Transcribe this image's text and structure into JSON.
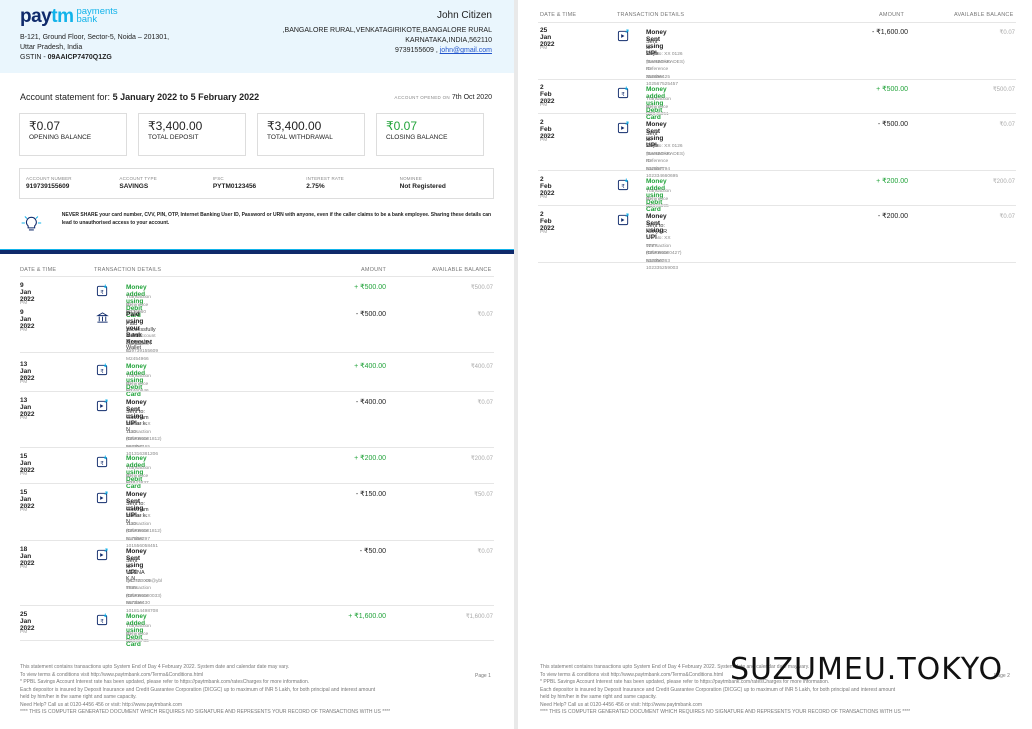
{
  "header": {
    "logo_brand": "paytm",
    "logo_sub1": "payments",
    "logo_sub2": "bank",
    "address1": "B-121, Ground Floor, Sector-5, Noida – 201301,",
    "address2": "Uttar Pradesh, India",
    "gstin_label": "GSTIN -",
    "gstin": "09AAICP7470Q1ZG",
    "customer_name": "John Citizen",
    "customer_addr1": ",BANGALORE RURAL,VENKATAGIRIKOTE,BANGALORE RURAL",
    "customer_addr2": "KARNATAKA,INDIA,562110",
    "customer_phone": "9739155609",
    "customer_email": "john@gmail.com"
  },
  "statement": {
    "label": "Account statement for:",
    "period": "5 January 2022 to 5 February 2022",
    "opened_label": "ACCOUNT OPENED ON",
    "opened": "7th Oct 2020"
  },
  "summary": [
    {
      "value": "₹0.07",
      "label": "OPENING BALANCE",
      "green": false
    },
    {
      "value": "₹3,400.00",
      "label": "TOTAL DEPOSIT",
      "green": false
    },
    {
      "value": "₹3,400.00",
      "label": "TOTAL WITHDRAWAL",
      "green": false
    },
    {
      "value": "₹0.07",
      "label": "CLOSING BALANCE",
      "green": true
    }
  ],
  "account": [
    {
      "key": "ACCOUNT NUMBER",
      "value": "919739155609"
    },
    {
      "key": "ACCOUNT TYPE",
      "value": "SAVINGS"
    },
    {
      "key": "IFSC",
      "value": "PYTM0123456"
    },
    {
      "key": "INTEREST RATE",
      "value": "2.75%"
    },
    {
      "key": "NOMINEE",
      "value": "Not Registered"
    }
  ],
  "warning": "NEVER SHARE your card number, CVV, PIN, OTP, Internet Banking User ID, Password or URN with anyone, even if the caller claims to be a bank employee. Sharing these details can lead to unauthorised access to your account.",
  "table_headers": {
    "date": "DATE & TIME",
    "details": "TRANSACTION DETAILS",
    "amount": "AMOUNT",
    "balance": "AVAILABLE BALANCE"
  },
  "page1_rows": [
    {
      "date": "9 Jan 2022",
      "time": "3:15 PM",
      "title": "Money added using Debit Card",
      "green": true,
      "sub": "",
      "lines": [
        "Transaction ID : M235960",
        "Reference No :"
      ],
      "amount": "+ ₹500.00",
      "balance": "₹500.07",
      "icon": "add"
    },
    {
      "date": "9 Jan 2022",
      "time": "3:39 PM",
      "title": "Paid using your Bank Account",
      "green": false,
      "sub": "Paid successfully at Add Money to Wallet",
      "lines": [
        "From Account Number 919739155609",
        "Transaction ID : M2454966"
      ],
      "amount": "- ₹500.00",
      "balance": "₹0.07",
      "icon": "bank"
    },
    {
      "date": "13 Jan 2022",
      "time": "2:17 PM",
      "title": "Money added using Debit Card",
      "green": true,
      "sub": "",
      "lines": [
        "Transaction ID : M2460846",
        "Reference No :"
      ],
      "amount": "+ ₹400.00",
      "balance": "₹400.07",
      "icon": "add"
    },
    {
      "date": "13 Jan 2022",
      "time": "2:21 PM",
      "title": "Money Sent using UPI",
      "green": false,
      "sub": "Sent to: Gautham kumar k. N",
      "lines": [
        "A/C No: XX 1122 (CNRB0001812)",
        "Transaction ID: 583357165",
        "Reference Number: 101316381206"
      ],
      "amount": "- ₹400.00",
      "balance": "₹0.07",
      "icon": "send"
    },
    {
      "date": "15 Jan 2022",
      "time": "1:41 PM",
      "title": "Money added using Debit Card",
      "green": true,
      "sub": "",
      "lines": [
        "Transaction ID : M2843837",
        "Reference No :"
      ],
      "amount": "+ ₹200.00",
      "balance": "₹200.07",
      "icon": "add"
    },
    {
      "date": "15 Jan 2022",
      "time": "1:43 PM",
      "title": "Money Sent using UPI",
      "green": false,
      "sub": "Sent to: Gautham kumar k. N",
      "lines": [
        "A/C No: XX 1122 (CNRB0001812)",
        "Transaction ID: 517588297",
        "Reference Number: 101556058451"
      ],
      "amount": "- ₹150.00",
      "balance": "₹50.07",
      "icon": "send"
    },
    {
      "date": "18 Jan 2022",
      "time": "12:44 PM",
      "title": "Money Sent using UPI",
      "green": false,
      "sub": "Sent to: VEENA K N",
      "lines": [
        "VPA: Q63770009@ybl",
        "A/C No: XX 8935 (CNRB0000033)",
        "Transaction ID: 567346430",
        "Reference Number: 101814498708"
      ],
      "amount": "- ₹50.00",
      "balance": "₹0.07",
      "icon": "send"
    },
    {
      "date": "25 Jan 2022",
      "time": "6:34 PM",
      "title": "Money added using Debit Card",
      "green": true,
      "sub": "",
      "lines": [
        "Transaction ID : M3805736",
        "Reference No :"
      ],
      "amount": "+ ₹1,600.00",
      "balance": "₹1,600.07",
      "icon": "add"
    }
  ],
  "page2_rows": [
    {
      "date": "25 Jan 2022",
      "time": "6:38 PM",
      "title": "Money Sent using UPI",
      "green": false,
      "sub": "Sent to: Priya",
      "lines": [
        "A/C No: XX 0126 (BARB0ARADES)",
        "Transaction ID: 355695425",
        "Reference Number: 102567525457"
      ],
      "amount": "- ₹1,600.00",
      "balance": "₹0.07",
      "icon": "send"
    },
    {
      "date": "2 Feb 2022",
      "time": "4:41 PM",
      "title": "Money added using Debit Card",
      "green": true,
      "sub": "",
      "lines": [
        "Transaction ID : M2945351",
        "Reference No :"
      ],
      "amount": "+ ₹500.00",
      "balance": "₹500.07",
      "icon": "add"
    },
    {
      "date": "2 Feb 2022",
      "time": "4:42 PM",
      "title": "Money Sent using UPI",
      "green": false,
      "sub": "Sent to: Priya",
      "lines": [
        "A/C No: XX 0126 (BARB0ARADES)",
        "Transaction ID: 532567794",
        "Reference Number: 102334660695"
      ],
      "amount": "- ₹500.00",
      "balance": "₹0.07",
      "icon": "send"
    },
    {
      "date": "2 Feb 2022",
      "time": "5:07 PM",
      "title": "Money added using Debit Card",
      "green": true,
      "sub": "",
      "lines": [
        "Transaction ID : M3696695",
        "Reference No :"
      ],
      "amount": "+ ₹200.00",
      "balance": "₹200.07",
      "icon": "add"
    },
    {
      "date": "2 Feb 2022",
      "time": "5:08 PM",
      "title": "Money Sent using UPI",
      "green": false,
      "sub": "Sent to: Nithya.R",
      "lines": [
        "A/C No: XX 0777 (CNRB0000427)",
        "Transaction ID: 533050363",
        "Reference Number: 102335259003"
      ],
      "amount": "- ₹200.00",
      "balance": "₹0.07",
      "icon": "send"
    }
  ],
  "footer_lines": [
    "This statement contains transactions upto System End of Day 4 February 2022. System date and calendar date may vary.",
    "To view terms & conditions visit http://www.paytmbank.com/Terms&Conditions.html",
    "* PPBL Savings Account Interest rate has been updated, please refer to https://paytmbank.com/ratesCharges for more information.",
    "Each depositor is insured by Deposit Insurance and Credit Guarantee Corporation (DICGC) up to maximum of INR 5 Lakh, for both principal and interest amount",
    "held by him/her in the same right and same capacity.",
    "Need Help? Call us at 0120-4456 456 or visit: http://www.paytmbank.com",
    "**** THIS IS COMPUTER GENERATED DOCUMENT WHICH REQUIRES NO SIGNATURE AND REPRESENTS YOUR RECORD OF TRANSACTIONS WITH US ****"
  ],
  "page1_label": "Page 1",
  "page2_label": "Page 2",
  "watermark": "SUZUMEU.TOKYO"
}
